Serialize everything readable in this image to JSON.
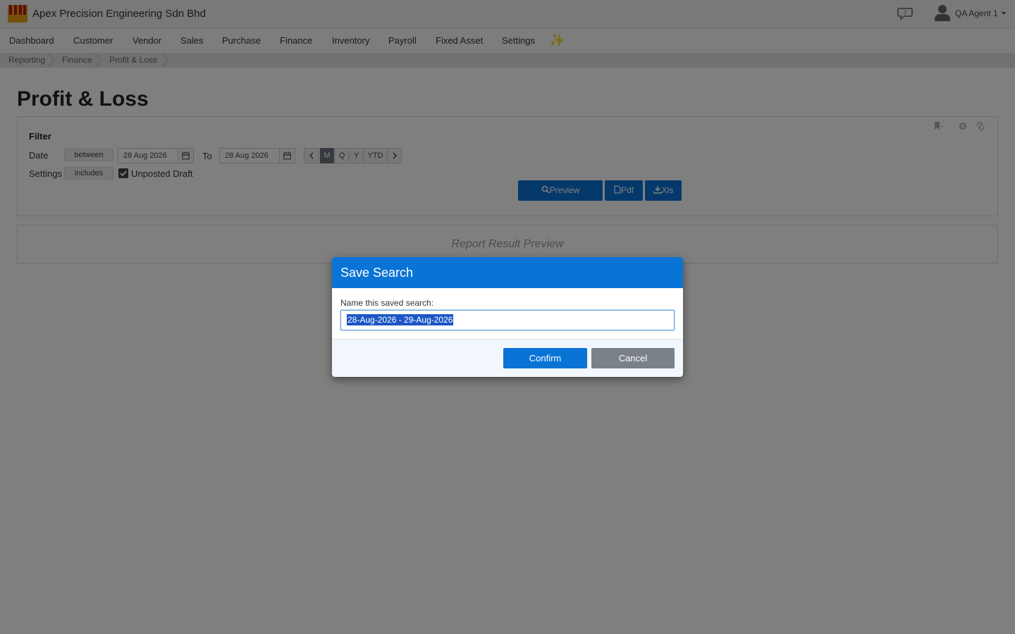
{
  "header": {
    "company": "Apex Precision Engineering Sdn Bhd",
    "user": "QA Agent 1",
    "logo_color": "#e8a317"
  },
  "nav": {
    "items": [
      "Dashboard",
      "Customer",
      "Vendor",
      "Sales",
      "Purchase",
      "Finance",
      "Inventory",
      "Payroll",
      "Fixed Asset",
      "Settings"
    ],
    "sparkle": "✨"
  },
  "breadcrumb": [
    "Reporting",
    "Finance",
    "Profit & Loss"
  ],
  "page": {
    "title": "Profit & Loss"
  },
  "filter": {
    "title": "Filter",
    "date_label": "Date",
    "date_op": "between",
    "date_from": "28 Aug 2026",
    "to_label": "To",
    "date_to": "28 Aug 2026",
    "period_buttons": [
      "M",
      "Q",
      "Y",
      "YTD"
    ],
    "active_period": "M",
    "settings_label": "Settings",
    "settings_op": "includes",
    "unposted_draft_label": "Unposted Draft",
    "unposted_draft_checked": true,
    "preview_label": "Preview",
    "pdf_label": "Pdf",
    "xls_label": "Xls"
  },
  "preview": {
    "placeholder": "Report Result Preview"
  },
  "modal": {
    "title": "Save Search",
    "field_label": "Name this saved search:",
    "field_value": "28-Aug-2026 - 29-Aug-2026",
    "confirm_label": "Confirm",
    "cancel_label": "Cancel"
  },
  "colors": {
    "primary": "#0a73d6",
    "secondary": "#7b8189",
    "overlay": "rgba(0,0,0,0.5)"
  }
}
